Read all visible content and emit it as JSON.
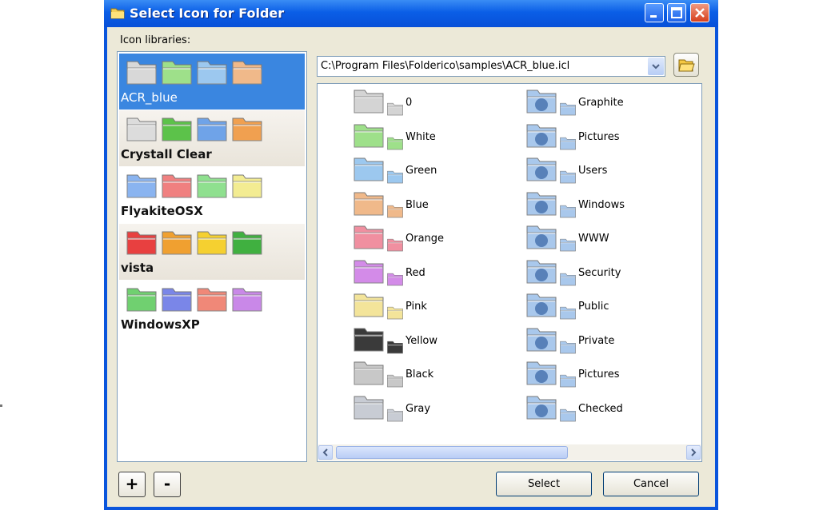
{
  "window": {
    "title": "Select Icon for Folder"
  },
  "libraries_label": "Icon libraries:",
  "libraries": [
    {
      "name": "ACR_blue",
      "selected": true,
      "colors": [
        "#d8d8d8",
        "#9ee08a",
        "#9cc8ef",
        "#f0b98a"
      ]
    },
    {
      "name": "Crystall Clear",
      "selected": false,
      "colors": [
        "#dcdcdc",
        "#5cc24a",
        "#6fa3e8",
        "#f0a050"
      ]
    },
    {
      "name": "FlyakiteOSX",
      "selected": false,
      "colors": [
        "#8ab4f0",
        "#f08080",
        "#8fe08f",
        "#f3ec92"
      ]
    },
    {
      "name": "vista",
      "selected": false,
      "colors": [
        "#e84040",
        "#f0a030",
        "#f5d030",
        "#40b040"
      ]
    },
    {
      "name": "WindowsXP",
      "selected": false,
      "colors": [
        "#70d070",
        "#7a86e8",
        "#f08878",
        "#c988e8"
      ]
    }
  ],
  "path_value": "C:\\Program Files\\Folderico\\samples\\ACR_blue.icl",
  "icons_left": [
    {
      "label": "0",
      "color": "#d4d4d4"
    },
    {
      "label": "White",
      "color": "#9ee08a"
    },
    {
      "label": "Green",
      "color": "#9cc8ef"
    },
    {
      "label": "Blue",
      "color": "#f0b98a"
    },
    {
      "label": "Orange",
      "color": "#f08fa0"
    },
    {
      "label": "Red",
      "color": "#d38be8"
    },
    {
      "label": "Pink",
      "color": "#f3e49a"
    },
    {
      "label": "Yellow",
      "color": "#3a3a3a"
    },
    {
      "label": "Black",
      "color": "#c8c8c8"
    },
    {
      "label": "Gray",
      "color": "#c8ccd4"
    }
  ],
  "icons_right": [
    {
      "label": "Graphite",
      "glyph": "graphite-icon"
    },
    {
      "label": "Pictures",
      "glyph": "person-icon"
    },
    {
      "label": "Users",
      "glyph": "users-icon"
    },
    {
      "label": "Windows",
      "glyph": "globe-icon"
    },
    {
      "label": "WWW",
      "glyph": "zipper-icon"
    },
    {
      "label": "Security",
      "glyph": "warning-icon"
    },
    {
      "label": "Public",
      "glyph": "no-entry-icon"
    },
    {
      "label": "Private",
      "glyph": "picture-icon"
    },
    {
      "label": "Pictures",
      "glyph": "plus-icon"
    },
    {
      "label": "Checked",
      "glyph": "disc-icon"
    }
  ],
  "buttons": {
    "add": "+",
    "remove": "-",
    "select": "Select",
    "cancel": "Cancel"
  }
}
